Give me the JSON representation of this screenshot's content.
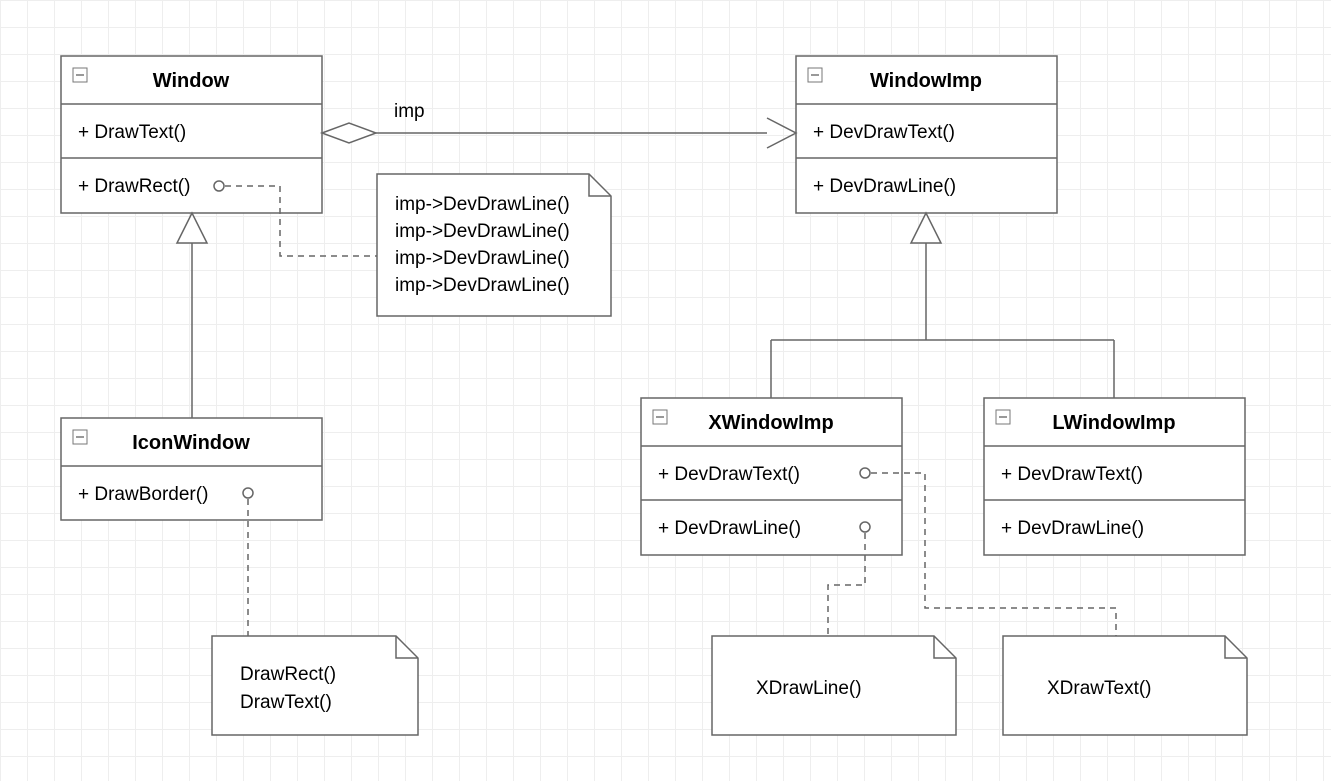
{
  "edgeLabel": "imp",
  "classes": {
    "window": {
      "title": "Window",
      "methods": [
        "+ DrawText()",
        "+ DrawRect()"
      ]
    },
    "windowImp": {
      "title": "WindowImp",
      "methods": [
        "+ DevDrawText()",
        "+ DevDrawLine()"
      ]
    },
    "iconWindow": {
      "title": "IconWindow",
      "methods": [
        "+ DrawBorder()"
      ]
    },
    "xWindowImp": {
      "title": "XWindowImp",
      "methods": [
        "+ DevDrawText()",
        "+ DevDrawLine()"
      ]
    },
    "lWindowImp": {
      "title": "LWindowImp",
      "methods": [
        "+ DevDrawText()",
        "+ DevDrawLine()"
      ]
    }
  },
  "notes": {
    "drawRect": {
      "lines": [
        "imp->DevDrawLine()",
        "imp->DevDrawLine()",
        "imp->DevDrawLine()",
        "imp->DevDrawLine()"
      ]
    },
    "drawBorder": {
      "lines": [
        "DrawRect()",
        "DrawText()"
      ]
    },
    "xDrawLine": {
      "lines": [
        "XDrawLine()"
      ]
    },
    "xDrawText": {
      "lines": [
        "XDrawText()"
      ]
    }
  }
}
